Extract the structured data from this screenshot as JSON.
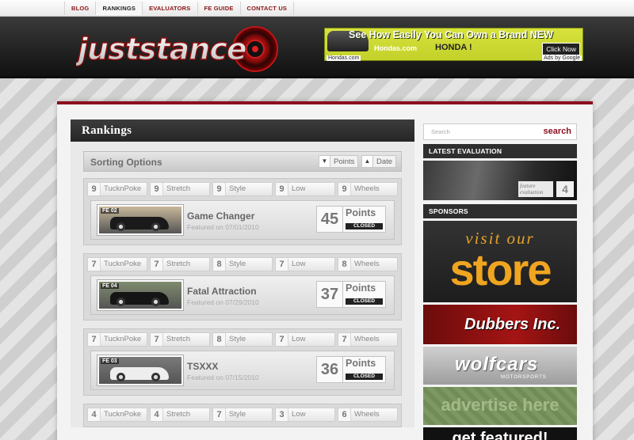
{
  "nav": {
    "items": [
      {
        "label": "BLOG",
        "active": false
      },
      {
        "label": "RANKINGS",
        "active": true
      },
      {
        "label": "EVALUATORS",
        "active": false
      },
      {
        "label": "FE GUIDE",
        "active": false
      },
      {
        "label": "CONTACT US",
        "active": false
      }
    ]
  },
  "header": {
    "logo_text": "juststance",
    "ad": {
      "headline": "See How Easily You Can Own a Brand NEW",
      "site": "Hondas.com",
      "brand": "HONDA !",
      "click": "Click Now",
      "url": "Hondas.com",
      "ads_by": "Ads by Google"
    }
  },
  "rankings": {
    "title": "Rankings",
    "sorting": {
      "label": "Sorting Options",
      "points_label": "Points",
      "date_label": "Date",
      "points_arrow": "▼",
      "date_arrow": "▲"
    },
    "score_labels": [
      "TucknPoke",
      "Stretch",
      "Style",
      "Low",
      "Wheels"
    ],
    "points_label": "Points",
    "closed_label": "CLOSED",
    "entries": [
      {
        "scores": [
          "9",
          "9",
          "9",
          "9",
          "9"
        ],
        "tag": "FE 02",
        "title": "Game Changer",
        "date": "Featured on 07/01/2010",
        "points": "45",
        "car_color": "#1a1a1a",
        "bg": "#c8b89a"
      },
      {
        "scores": [
          "7",
          "7",
          "8",
          "7",
          "8"
        ],
        "tag": "FE 04",
        "title": "Fatal Attraction",
        "date": "Featured on 07/29/2010",
        "points": "37",
        "car_color": "#151515",
        "bg": "#7e8b6e"
      },
      {
        "scores": [
          "7",
          "7",
          "8",
          "7",
          "7"
        ],
        "tag": "FE 03",
        "title": "TSXXX",
        "date": "Featured on 07/15/2010",
        "points": "36",
        "car_color": "#eeeeee",
        "bg": "#7a7a7a"
      },
      {
        "scores": [
          "4",
          "4",
          "7",
          "3",
          "6"
        ],
        "tag": "",
        "title": "",
        "date": "",
        "points": "",
        "car_color": "#444444",
        "bg": "#888888"
      }
    ]
  },
  "sidebar": {
    "search_placeholder": "Search",
    "search_button": "search",
    "latest_title": "LATEST EVALUATION",
    "latest_label": "feature evaluation",
    "latest_count": "4",
    "sponsors_title": "SPONSORS",
    "sponsors": {
      "store_small": "visit our",
      "store_big": "store",
      "dubbers": "Dubbers Inc.",
      "wolf": "wolfcars",
      "wolf_sub": "MOTORSPORTS",
      "advertise": "advertise here",
      "featured": "get featured!"
    }
  },
  "colors": {
    "accent": "#8b0f1e",
    "dark": "#2e2e2e"
  }
}
